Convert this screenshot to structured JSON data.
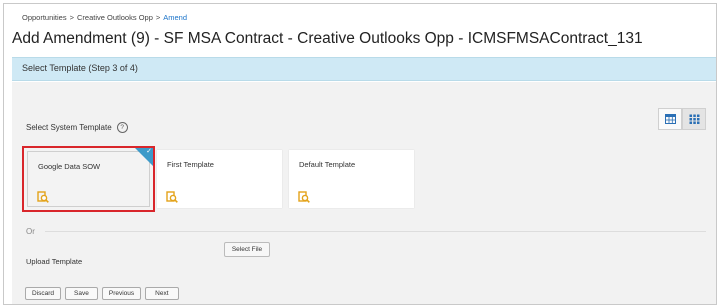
{
  "breadcrumb": {
    "items": [
      "Opportunities",
      "Creative Outlooks Opp",
      "Amend"
    ],
    "separator": ">"
  },
  "page": {
    "title": "Add Amendment (9) - SF MSA Contract - Creative Outlooks Opp - ICMSFMSAContract_131"
  },
  "step": {
    "label": "Select Template (Step 3 of 4)"
  },
  "templates": {
    "section_label": "Select System Template",
    "help_icon": "?",
    "view_icons": [
      "table-view-icon",
      "grid-view-icon"
    ],
    "items": [
      {
        "name": "Google Data SOW",
        "selected": true
      },
      {
        "name": "First Template",
        "selected": false
      },
      {
        "name": "Default Template",
        "selected": false
      }
    ]
  },
  "upload": {
    "or_label": "Or",
    "select_file_label": "Select File",
    "upload_label": "Upload Template"
  },
  "actions": {
    "discard": "Discard",
    "save": "Save",
    "previous": "Previous",
    "next": "Next"
  },
  "colors": {
    "step_bar": "#cfe9f5",
    "selection_outline": "#d9262b",
    "check_corner": "#3c9ac9",
    "preview_icon": "#e3a31a",
    "link": "#1a73c9"
  }
}
